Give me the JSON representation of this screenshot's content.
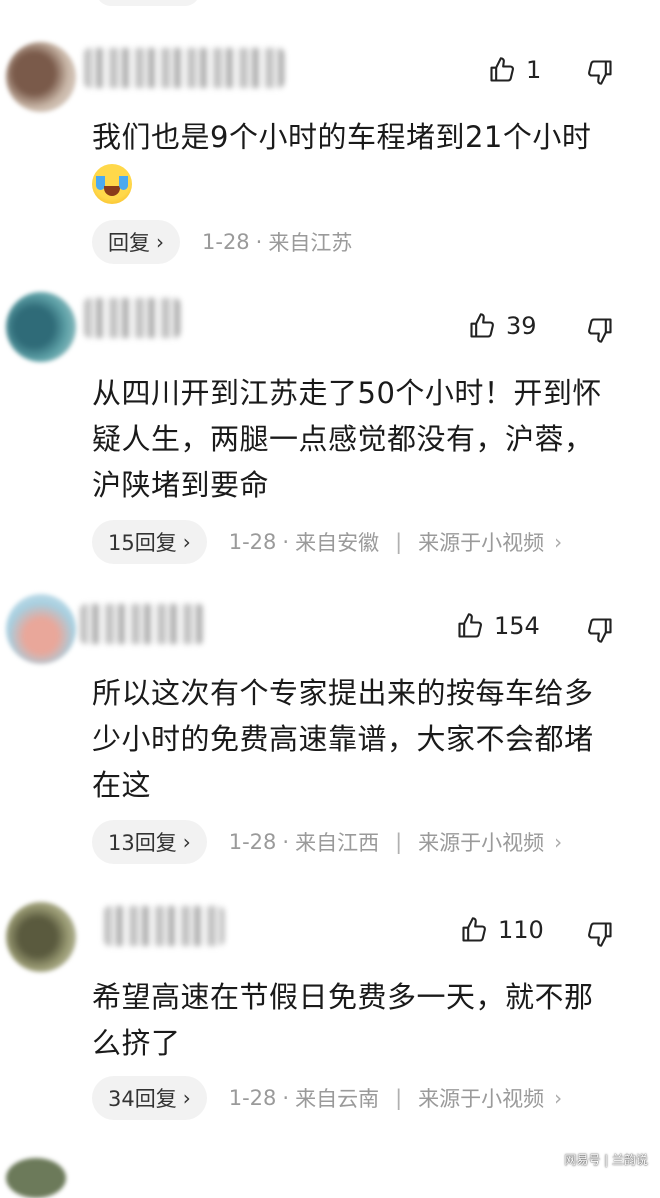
{
  "comments": [
    {
      "likes": "1",
      "text_lines": [
        "我们也是9个小时的车程堵到21个小时"
      ],
      "has_emoji": true,
      "reply_label": "回复",
      "date": "1-28",
      "location": "来自江苏",
      "source": ""
    },
    {
      "likes": "39",
      "text_lines": [
        "从四川开到江苏走了50个小时！开到怀",
        "疑人生，两腿一点感觉都没有，沪蓉，",
        "沪陕堵到要命"
      ],
      "reply_label": "15回复",
      "date": "1-28",
      "location": "来自安徽",
      "source": "来源于小视频"
    },
    {
      "likes": "154",
      "text_lines": [
        "所以这次有个专家提出来的按每车给多",
        "少小时的免费高速靠谱，大家不会都堵",
        "在这"
      ],
      "reply_label": "13回复",
      "date": "1-28",
      "location": "来自江西",
      "source": "来源于小视频"
    },
    {
      "likes": "110",
      "text_lines": [
        "希望高速在节假日免费多一天，就不那",
        "么挤了"
      ],
      "reply_label": "34回复",
      "date": "1-28",
      "location": "来自云南",
      "source": "来源于小视频"
    }
  ],
  "separator_dot": "·",
  "separator_bar": "|",
  "chevron": "›",
  "watermark": "网易号 | 兰韵说",
  "icons": {
    "like": "thumbs-up-icon",
    "dislike": "thumbs-down-icon",
    "laugh_cry": "laugh-cry-emoji-icon"
  }
}
